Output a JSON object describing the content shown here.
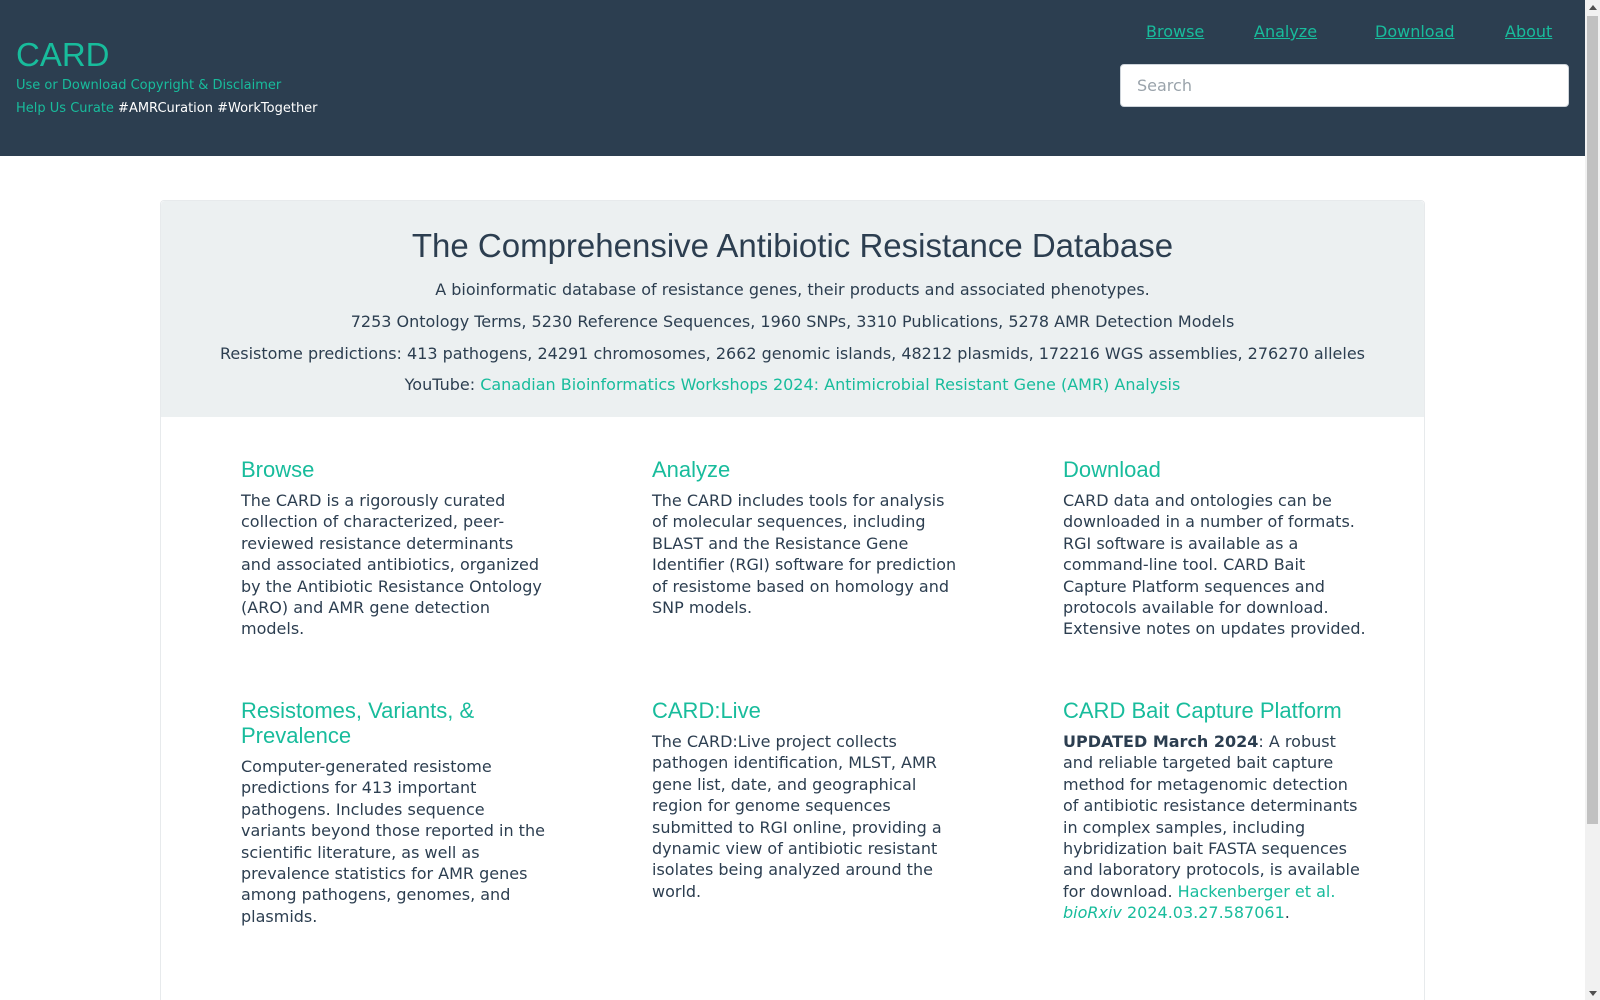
{
  "header": {
    "brand": "CARD",
    "sub_link": "Use or Download Copyright & Disclaimer",
    "curate_link": "Help Us Curate",
    "hashtags": " #AMRCuration #WorkTogether",
    "nav": [
      "Browse",
      "Analyze",
      "Download",
      "About"
    ],
    "search_placeholder": "Search"
  },
  "hero": {
    "title": "The Comprehensive Antibiotic Resistance Database",
    "subtitle": "A bioinformatic database of resistance genes, their products and associated phenotypes.",
    "stats": "7253 Ontology Terms, 5230 Reference Sequences, 1960 SNPs, 3310 Publications, 5278 AMR Detection Models",
    "predictions": "Resistome predictions: 413 pathogens, 24291 chromosomes, 2662 genomic islands, 48212 plasmids, 172216 WGS assemblies, 276270 alleles",
    "youtube_label": "YouTube: ",
    "youtube_link": "Canadian Bioinformatics Workshops 2024: Antimicrobial Resistant Gene (AMR) Analysis"
  },
  "features": [
    {
      "title": "Browse",
      "text": "The CARD is a rigorously curated collection of characterized, peer-reviewed resistance determinants and associated antibiotics, organized by the Antibiotic Resistance Ontology (ARO) and AMR gene detection models."
    },
    {
      "title": "Analyze",
      "text": "The CARD includes tools for analysis of molecular sequences, including BLAST and the Resistance Gene Identifier (RGI) software for prediction of resistome based on homology and SNP models."
    },
    {
      "title": "Download",
      "text": "CARD data and ontologies can be downloaded in a number of formats. RGI software is available as a command-line tool. CARD Bait Capture Platform sequences and protocols available for download. Extensive notes on updates provided."
    },
    {
      "title": "Resistomes, Variants, & Prevalence",
      "text": "Computer-generated resistome predictions for 413 important pathogens. Includes sequence variants beyond those reported in the scientific literature, as well as prevalence statistics for AMR genes among pathogens, genomes, and plasmids."
    },
    {
      "title": "CARD:Live",
      "text": "The CARD:Live project collects pathogen identification, MLST, AMR gene list, date, and geographical region for genome sequences submitted to RGI online, providing a dynamic view of antibiotic resistant isolates being analyzed around the world."
    },
    {
      "title": "CARD Bait Capture Platform",
      "bold": "UPDATED March 2024",
      "text": ": A robust and reliable targeted bait capture method for metagenomic detection of antibiotic resistance determinants in complex samples, including hybridization bait FASTA sequences and laboratory protocols, is available for download. ",
      "link_authors": "Hackenberger et al. ",
      "link_journal": "bioRxiv",
      "link_id": " 2024.03.27.587061",
      "end": "."
    }
  ],
  "colors": {
    "navbar": "#2c3e50",
    "accent": "#18bc9c",
    "jumbotron": "#ecf0f1",
    "text": "#2c3e50"
  },
  "icons": [
    "scroll-up-arrow-icon",
    "scroll-down-arrow-icon"
  ]
}
